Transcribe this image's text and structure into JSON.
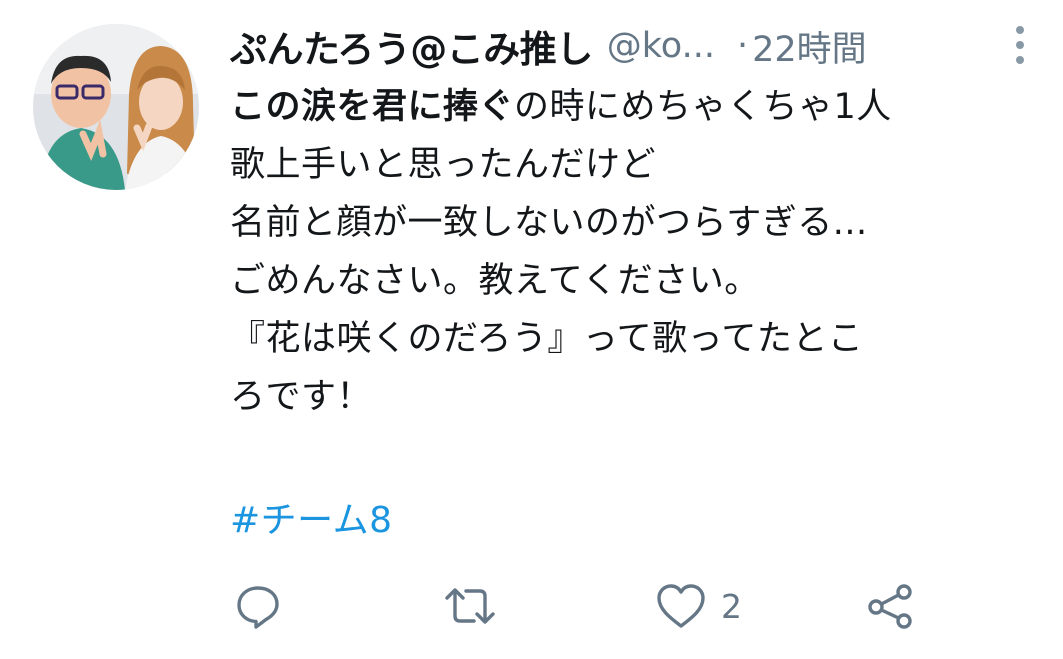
{
  "tweet": {
    "display_name": "ぷんたろう@こみ推し",
    "handle": "@ko...",
    "separator": "·",
    "time": "22時間",
    "text_bold": "この涙を君に捧ぐ",
    "text_line1_rest": "の時にめちゃくちゃ1人",
    "text_line2": "歌上手いと思ったんだけど",
    "text_line3": "名前と顔が一致しないのがつらすぎる...",
    "text_line4": "ごめんなさい。教えてください。",
    "text_line5": "『花は咲くのだろう』って歌ってたとこ",
    "text_line6": "ろです！",
    "hashtag": "#チーム8"
  },
  "actions": {
    "reply_icon": "reply-icon",
    "retweet_icon": "retweet-icon",
    "like_icon": "heart-icon",
    "like_count": "2",
    "share_icon": "share-icon"
  },
  "colors": {
    "text": "#14171a",
    "secondary": "#657786",
    "link": "#1b95e0"
  }
}
